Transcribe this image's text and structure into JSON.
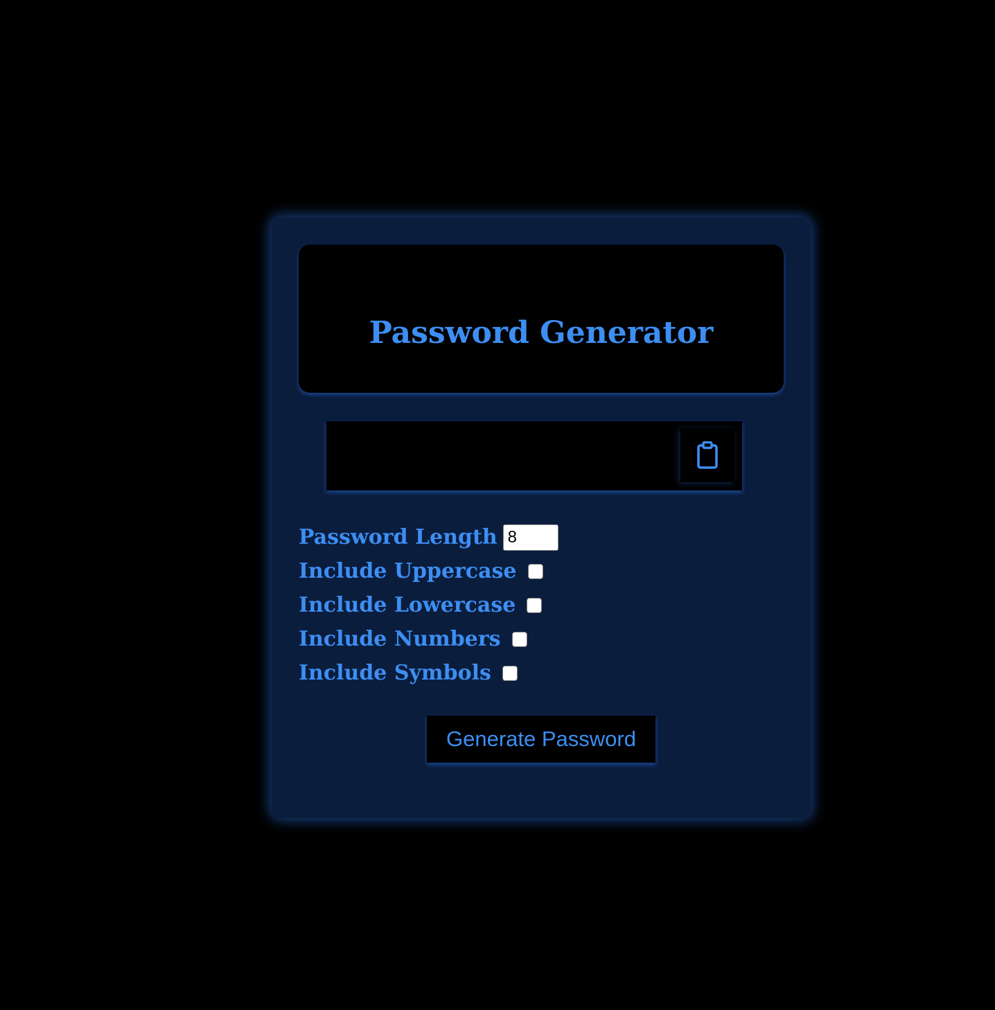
{
  "header": {
    "title": "Password Generator"
  },
  "output": {
    "value": "",
    "copy_icon": "clipboard-icon"
  },
  "options": {
    "length_label": "Password Length",
    "length_value": "8",
    "uppercase_label": "Include Uppercase",
    "uppercase_checked": false,
    "lowercase_label": "Include Lowercase",
    "lowercase_checked": false,
    "numbers_label": "Include Numbers",
    "numbers_checked": false,
    "symbols_label": "Include Symbols",
    "symbols_checked": false
  },
  "actions": {
    "generate_label": "Generate Password"
  },
  "colors": {
    "background": "#000000",
    "card": "#0a1d3d",
    "accent": "#3d8ef2"
  }
}
